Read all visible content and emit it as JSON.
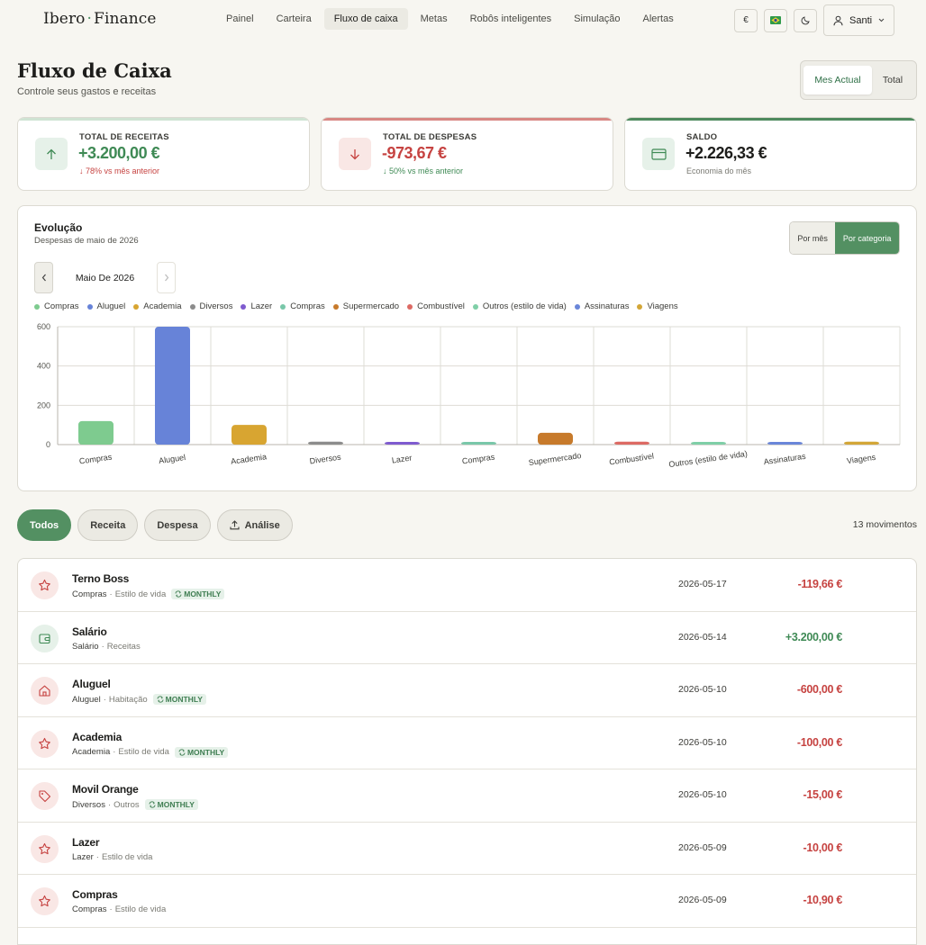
{
  "brand": {
    "name_left": "Ibero",
    "separator": "·",
    "name_right": "Finance"
  },
  "nav": [
    {
      "label": "Painel",
      "active": false
    },
    {
      "label": "Carteira",
      "active": false
    },
    {
      "label": "Fluxo de caixa",
      "active": true
    },
    {
      "label": "Metas",
      "active": false
    },
    {
      "label": "Robôs inteligentes",
      "active": false
    },
    {
      "label": "Simulação",
      "active": false
    },
    {
      "label": "Alertas",
      "active": false
    }
  ],
  "top_actions": {
    "currency": "€",
    "user": "Santi"
  },
  "header": {
    "title": "Fluxo de Caixa",
    "subtitle": "Controle seus gastos e receitas"
  },
  "period": {
    "current": "Mes Actual",
    "total": "Total"
  },
  "stats": {
    "income": {
      "label": "TOTAL DE RECEITAS",
      "value": "+3.200,00 €",
      "note": "↓ 78% vs mês anterior",
      "color": "#3f8a55",
      "note_color": "#c64341"
    },
    "expense": {
      "label": "TOTAL DE DESPESAS",
      "value": "-973,67 €",
      "note": "↓ 50% vs mês anterior",
      "color": "#c64341",
      "note_color": "#3f8a55"
    },
    "balance": {
      "label": "SALDO",
      "value": "+2.226,33 €",
      "note": "Economia do mês",
      "color": "#1d1d1b",
      "note_color": "#7a7a73"
    }
  },
  "chart_panel": {
    "title": "Evolução",
    "subtitle": "Despesas de maio de 2026",
    "mode_month": "Por mês",
    "mode_category": "Por categoria",
    "month": "Maio De 2026"
  },
  "chart_data": {
    "type": "bar",
    "title": "",
    "xlabel": "",
    "ylabel": "",
    "ylim": [
      0,
      600
    ],
    "yticks": [
      0,
      200,
      400,
      600
    ],
    "grid": true,
    "legend_position": "top-left",
    "categories": [
      "Compras",
      "Aluguel",
      "Academia",
      "Diversos",
      "Lazer",
      "Compras",
      "Supermercado",
      "Combustível",
      "Outros (estilo de vida)",
      "Assinaturas",
      "Viagens"
    ],
    "values": [
      119.66,
      600,
      100,
      15,
      10,
      10.9,
      60,
      15,
      12,
      10,
      15
    ],
    "colors": [
      "#7ecb8f",
      "#6783d8",
      "#d8a531",
      "#8c8c8c",
      "#7f5bcf",
      "#79c7a9",
      "#c77a2b",
      "#dd6a64",
      "#7fcfa7",
      "#6a86d9",
      "#d3a637"
    ]
  },
  "filters": [
    {
      "label": "Todos",
      "active": true
    },
    {
      "label": "Receita",
      "active": false
    },
    {
      "label": "Despesa",
      "active": false
    },
    {
      "label": "Análise",
      "active": false
    }
  ],
  "movements": "13 movimentos",
  "transactions": [
    {
      "name": "Terno Boss",
      "category": "Compras",
      "sub": "Estilo de vida",
      "badge": "MONTHLY",
      "date": "2026-05-17",
      "amount": "-119,66 €",
      "type": "exp",
      "icon": "star-icon"
    },
    {
      "name": "Salário",
      "category": "Salário",
      "sub": "Receitas",
      "badge": "",
      "date": "2026-05-14",
      "amount": "+3.200,00 €",
      "type": "inc",
      "icon": "wallet-icon"
    },
    {
      "name": "Aluguel",
      "category": "Aluguel",
      "sub": "Habitação",
      "badge": "MONTHLY",
      "date": "2026-05-10",
      "amount": "-600,00 €",
      "type": "exp",
      "icon": "home-icon"
    },
    {
      "name": "Academia",
      "category": "Academia",
      "sub": "Estilo de vida",
      "badge": "MONTHLY",
      "date": "2026-05-10",
      "amount": "-100,00 €",
      "type": "exp",
      "icon": "star-icon"
    },
    {
      "name": "Movil Orange",
      "category": "Diversos",
      "sub": "Outros",
      "badge": "MONTHLY",
      "date": "2026-05-10",
      "amount": "-15,00 €",
      "type": "exp",
      "icon": "tag-icon"
    },
    {
      "name": "Lazer",
      "category": "Lazer",
      "sub": "Estilo de vida",
      "badge": "",
      "date": "2026-05-09",
      "amount": "-10,00 €",
      "type": "exp",
      "icon": "star-icon"
    },
    {
      "name": "Compras",
      "category": "Compras",
      "sub": "Estilo de vida",
      "badge": "",
      "date": "2026-05-09",
      "amount": "-10,90 €",
      "type": "exp",
      "icon": "star-icon"
    }
  ]
}
